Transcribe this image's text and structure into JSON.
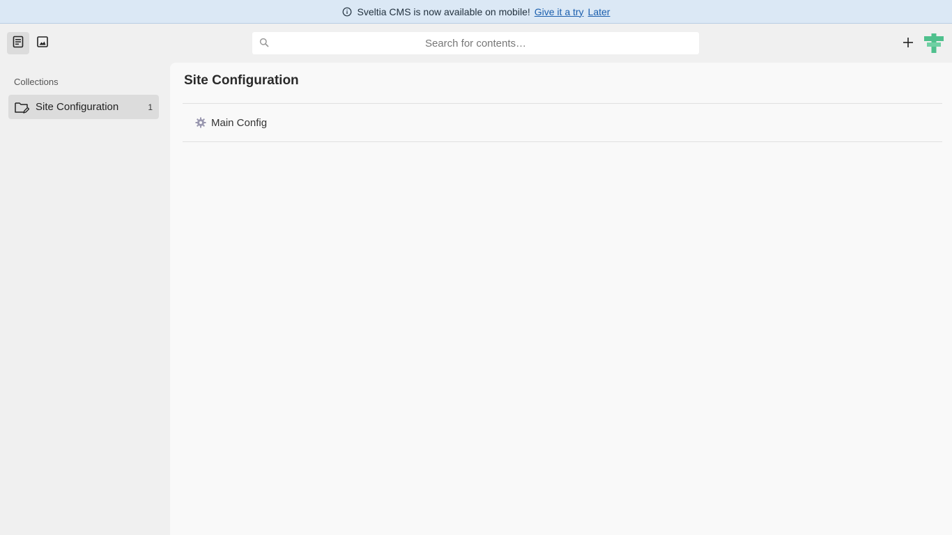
{
  "banner": {
    "message": "Sveltia CMS is now available on mobile!",
    "try_link": "Give it a try",
    "later_link": "Later"
  },
  "search": {
    "placeholder": "Search for contents…"
  },
  "sidebar": {
    "heading": "Collections",
    "collections": [
      {
        "label": "Site Configuration",
        "count": "1"
      }
    ]
  },
  "main": {
    "title": "Site Configuration",
    "entries": [
      {
        "label": "Main Config"
      }
    ]
  },
  "colors": {
    "banner_bg": "#dbe8f5",
    "link": "#1b5fae",
    "logo_green": "#4fc08d"
  },
  "icons": [
    "info-icon",
    "entries-icon",
    "assets-icon",
    "search-icon",
    "plus-icon",
    "logo-icon",
    "folder-edit-icon",
    "gear-icon"
  ]
}
